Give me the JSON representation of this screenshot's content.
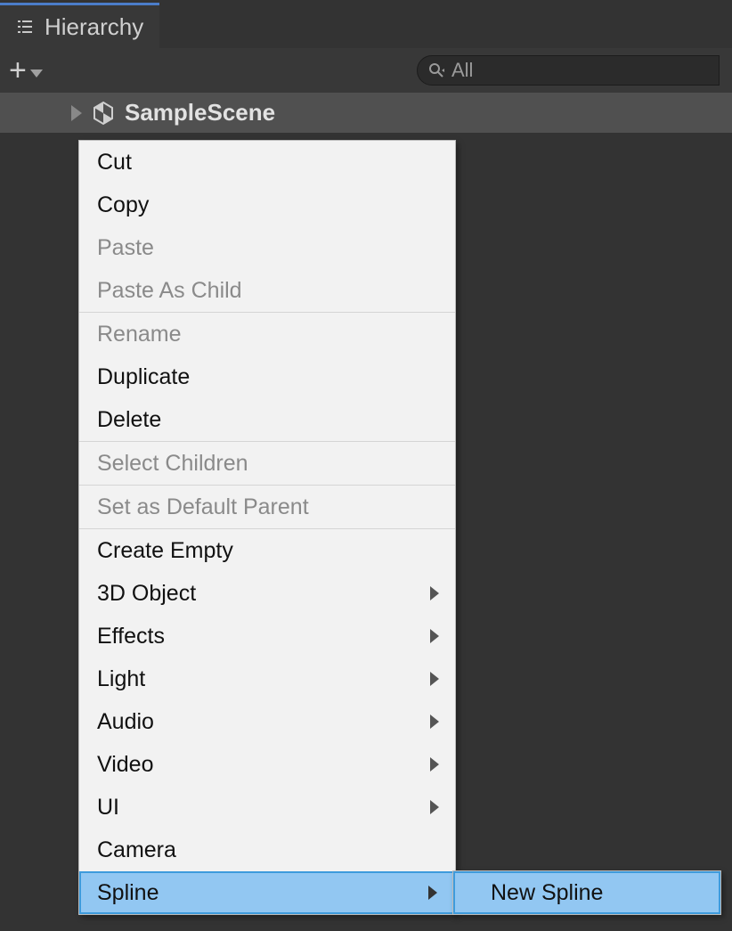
{
  "tab": {
    "label": "Hierarchy"
  },
  "search": {
    "placeholder": "All"
  },
  "scene": {
    "name": "SampleScene"
  },
  "context_menu": {
    "items": [
      {
        "label": "Cut",
        "disabled": false,
        "submenu": false,
        "sep": false
      },
      {
        "label": "Copy",
        "disabled": false,
        "submenu": false,
        "sep": false
      },
      {
        "label": "Paste",
        "disabled": true,
        "submenu": false,
        "sep": false
      },
      {
        "label": "Paste As Child",
        "disabled": true,
        "submenu": false,
        "sep": true
      },
      {
        "label": "Rename",
        "disabled": true,
        "submenu": false,
        "sep": false
      },
      {
        "label": "Duplicate",
        "disabled": false,
        "submenu": false,
        "sep": false
      },
      {
        "label": "Delete",
        "disabled": false,
        "submenu": false,
        "sep": true
      },
      {
        "label": "Select Children",
        "disabled": true,
        "submenu": false,
        "sep": true
      },
      {
        "label": "Set as Default Parent",
        "disabled": true,
        "submenu": false,
        "sep": true
      },
      {
        "label": "Create Empty",
        "disabled": false,
        "submenu": false,
        "sep": false
      },
      {
        "label": "3D Object",
        "disabled": false,
        "submenu": true,
        "sep": false
      },
      {
        "label": "Effects",
        "disabled": false,
        "submenu": true,
        "sep": false
      },
      {
        "label": "Light",
        "disabled": false,
        "submenu": true,
        "sep": false
      },
      {
        "label": "Audio",
        "disabled": false,
        "submenu": true,
        "sep": false
      },
      {
        "label": "Video",
        "disabled": false,
        "submenu": true,
        "sep": false
      },
      {
        "label": "UI",
        "disabled": false,
        "submenu": true,
        "sep": false
      },
      {
        "label": "Camera",
        "disabled": false,
        "submenu": false,
        "sep": false
      },
      {
        "label": "Spline",
        "disabled": false,
        "submenu": true,
        "sep": false,
        "highlight": true
      }
    ],
    "submenu": {
      "items": [
        {
          "label": "New Spline",
          "highlight": true
        }
      ]
    }
  }
}
